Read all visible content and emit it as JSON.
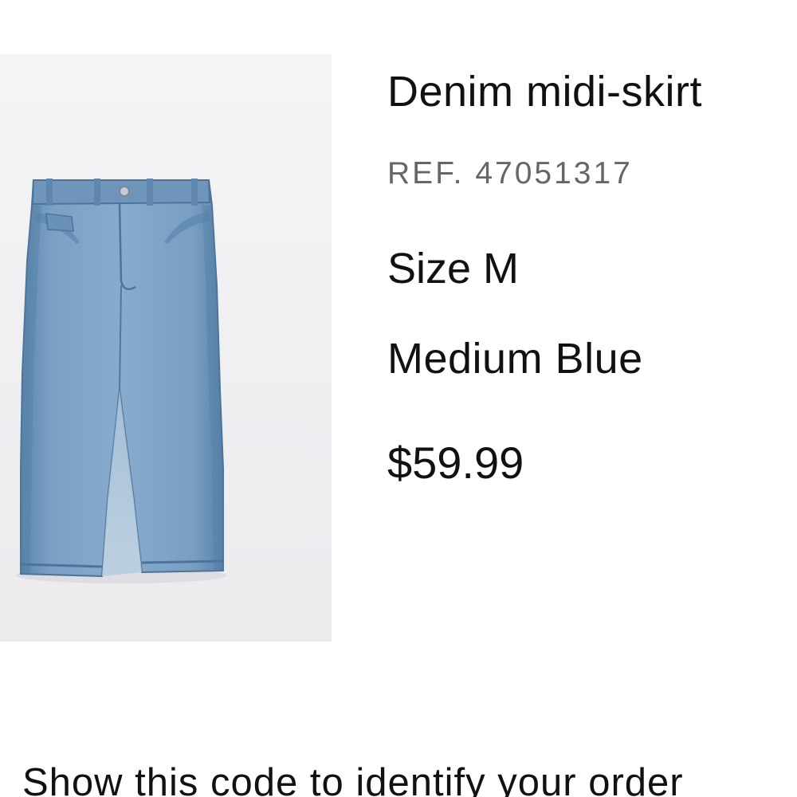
{
  "product": {
    "name": "Denim midi-skirt",
    "ref": "REF. 47051317",
    "size": "Size M",
    "color": "Medium Blue",
    "price": "$59.99"
  },
  "footer": {
    "note": "Show this code to identify your order"
  }
}
